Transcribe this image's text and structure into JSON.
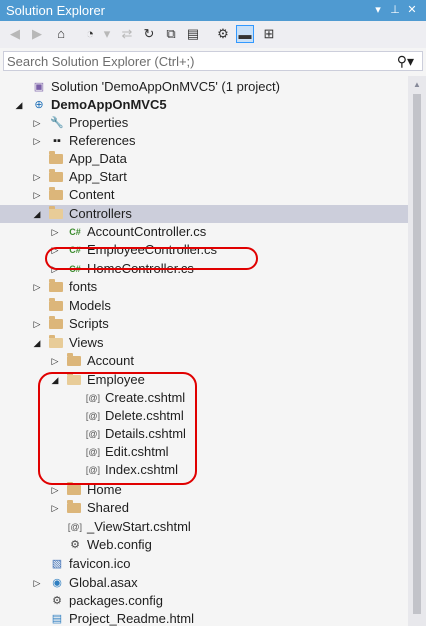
{
  "window": {
    "title": "Solution Explorer",
    "controls": [
      "pin-dropdown",
      "auto-hide-pin",
      "close"
    ]
  },
  "toolbar": {
    "icons": [
      "back-icon",
      "forward-icon",
      "home-icon",
      "history-icon",
      "sync-icon",
      "refresh-icon",
      "collapse-all-icon",
      "show-all-files-icon",
      "properties-icon",
      "preview-icon",
      "class-diagram-icon"
    ]
  },
  "search": {
    "placeholder": "Search Solution Explorer (Ctrl+;)",
    "value": ""
  },
  "tree": [
    {
      "label": "Solution 'DemoAppOnMVC5' (1 project)",
      "icon": "solution-icon",
      "expander": ""
    },
    {
      "label": "DemoAppOnMVC5",
      "icon": "web-project-icon",
      "expander": "expanded",
      "bold": true
    },
    {
      "label": "Properties",
      "icon": "wrench-icon",
      "expander": "collapsed"
    },
    {
      "label": "References",
      "icon": "references-icon",
      "expander": "collapsed"
    },
    {
      "label": "App_Data",
      "icon": "folder-icon",
      "expander": ""
    },
    {
      "label": "App_Start",
      "icon": "folder-icon",
      "expander": "collapsed"
    },
    {
      "label": "Content",
      "icon": "folder-icon",
      "expander": "collapsed"
    },
    {
      "label": "Controllers",
      "icon": "open-folder-icon",
      "expander": "expanded",
      "selected": true
    },
    {
      "label": "AccountController.cs",
      "icon": "csharp-file-icon",
      "expander": "collapsed"
    },
    {
      "label": "EmployeeController.cs",
      "icon": "csharp-file-icon",
      "expander": "collapsed"
    },
    {
      "label": "HomeController.cs",
      "icon": "csharp-file-icon",
      "expander": "collapsed"
    },
    {
      "label": "fonts",
      "icon": "folder-icon",
      "expander": "collapsed"
    },
    {
      "label": "Models",
      "icon": "folder-icon",
      "expander": ""
    },
    {
      "label": "Scripts",
      "icon": "folder-icon",
      "expander": "collapsed"
    },
    {
      "label": "Views",
      "icon": "open-folder-icon",
      "expander": "expanded"
    },
    {
      "label": "Account",
      "icon": "folder-icon",
      "expander": "collapsed"
    },
    {
      "label": "Employee",
      "icon": "open-folder-icon",
      "expander": "expanded"
    },
    {
      "label": "Create.cshtml",
      "icon": "razor-file-icon",
      "expander": ""
    },
    {
      "label": "Delete.cshtml",
      "icon": "razor-file-icon",
      "expander": ""
    },
    {
      "label": "Details.cshtml",
      "icon": "razor-file-icon",
      "expander": ""
    },
    {
      "label": "Edit.cshtml",
      "icon": "razor-file-icon",
      "expander": ""
    },
    {
      "label": "Index.cshtml",
      "icon": "razor-file-icon",
      "expander": ""
    },
    {
      "label": "Home",
      "icon": "folder-icon",
      "expander": "collapsed"
    },
    {
      "label": "Shared",
      "icon": "folder-icon",
      "expander": "collapsed"
    },
    {
      "label": "_ViewStart.cshtml",
      "icon": "razor-file-icon",
      "expander": ""
    },
    {
      "label": "Web.config",
      "icon": "config-file-icon",
      "expander": ""
    },
    {
      "label": "favicon.ico",
      "icon": "ico-file-icon",
      "expander": ""
    },
    {
      "label": "Global.asax",
      "icon": "global-asax-icon",
      "expander": "collapsed"
    },
    {
      "label": "packages.config",
      "icon": "config-file-icon",
      "expander": ""
    },
    {
      "label": "Project_Readme.html",
      "icon": "html-file-icon",
      "expander": ""
    }
  ],
  "colors": {
    "titlebar": "#4f9ad1",
    "selection": "#cccedb",
    "annotation": "#e00000",
    "folder": "#dcb67a"
  }
}
